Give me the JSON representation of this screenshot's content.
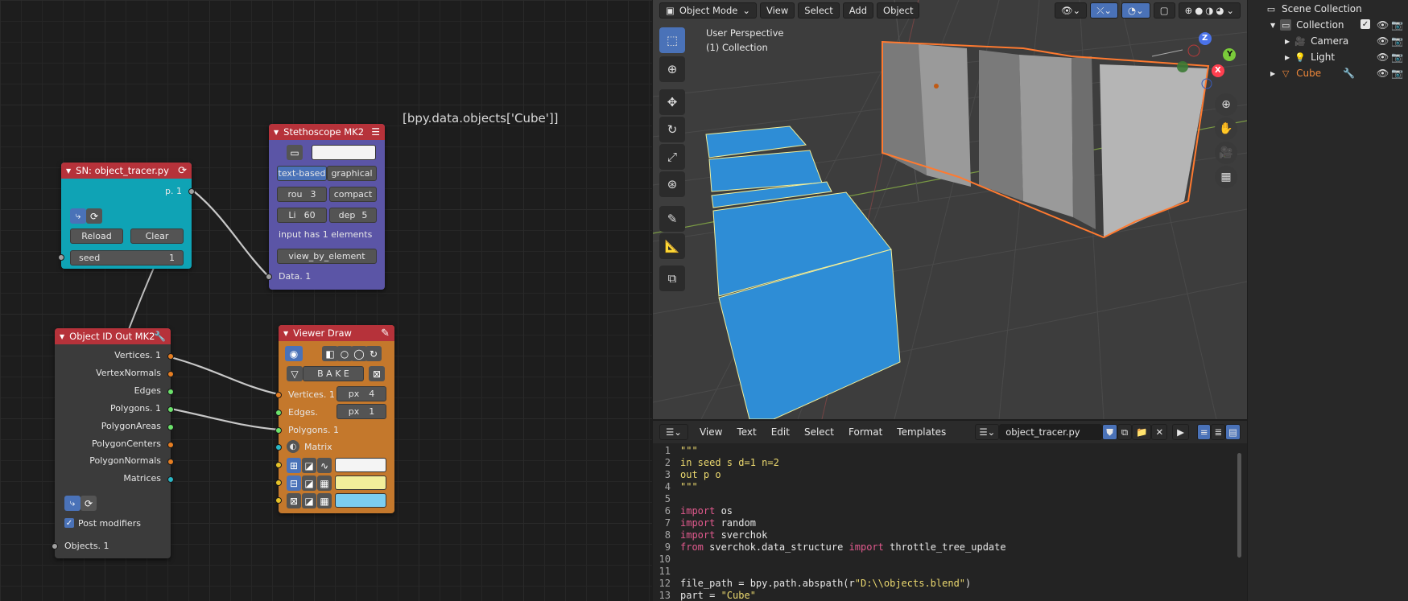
{
  "node_editor": {
    "floating_label": "[bpy.data.objects['Cube']]",
    "sn_node": {
      "title": "SN: object_tracer.py",
      "output": "p. 1",
      "reload": "Reload",
      "clear": "Clear",
      "seed_label": "seed",
      "seed_value": "1"
    },
    "stethoscope": {
      "title": "Stethoscope MK2",
      "mode_text": "text-based",
      "mode_graph": "graphical",
      "rou_label": "rou",
      "rou_value": "3",
      "compact": "compact",
      "li_label": "Li",
      "li_value": "60",
      "dep_label": "dep",
      "dep_value": "5",
      "info": "input has 1 elements",
      "view_btn": "view_by_element",
      "data_in": "Data. 1"
    },
    "object_id": {
      "title": "Object ID Out MK2",
      "outputs": [
        "Vertices. 1",
        "VertexNormals",
        "Edges",
        "Polygons. 1",
        "PolygonAreas",
        "PolygonCenters",
        "PolygonNormals",
        "Matrices"
      ],
      "post_modifiers": "Post modifiers",
      "objects_in": "Objects. 1"
    },
    "viewer": {
      "title": "Viewer Draw",
      "bake": "B A K E",
      "vertices": "Vertices. 1",
      "edges": "Edges.",
      "polygons": "Polygons. 1",
      "matrix": "Matrix",
      "px_label": "px",
      "px_vert": "4",
      "px_edge": "1",
      "colors": {
        "vert": "#f4f4f4",
        "edge": "#f2ef9a",
        "poly": "#7ccdf0"
      }
    }
  },
  "viewport": {
    "mode": "Object Mode",
    "menus": [
      "View",
      "Select",
      "Add",
      "Object"
    ],
    "perspective": "User Perspective",
    "collection": "(1) Collection",
    "axes": {
      "x": "X",
      "y": "Y",
      "z": "Z"
    }
  },
  "text_editor": {
    "menus": [
      "View",
      "Text",
      "Edit",
      "Select",
      "Format",
      "Templates"
    ],
    "filename": "object_tracer.py",
    "lines": [
      {
        "n": "1",
        "parts": [
          {
            "t": "\"\"\"",
            "c": "y"
          }
        ]
      },
      {
        "n": "2",
        "parts": [
          {
            "t": "in seed s d=1 n=2",
            "c": "y"
          }
        ]
      },
      {
        "n": "3",
        "parts": [
          {
            "t": "out p o",
            "c": "y"
          }
        ]
      },
      {
        "n": "4",
        "parts": [
          {
            "t": "\"\"\"",
            "c": "y"
          }
        ]
      },
      {
        "n": "5",
        "parts": []
      },
      {
        "n": "6",
        "parts": [
          {
            "t": "import",
            "c": "k"
          },
          {
            "t": " os",
            "c": "w"
          }
        ]
      },
      {
        "n": "7",
        "parts": [
          {
            "t": "import",
            "c": "k"
          },
          {
            "t": " random",
            "c": "w"
          }
        ]
      },
      {
        "n": "8",
        "parts": [
          {
            "t": "import",
            "c": "k"
          },
          {
            "t": " sverchok",
            "c": "w"
          }
        ]
      },
      {
        "n": "9",
        "parts": [
          {
            "t": "from",
            "c": "k"
          },
          {
            "t": " sverchok.data_structure ",
            "c": "w"
          },
          {
            "t": "import",
            "c": "k"
          },
          {
            "t": " throttle_tree_update",
            "c": "w"
          }
        ]
      },
      {
        "n": "10",
        "parts": []
      },
      {
        "n": "11",
        "parts": []
      },
      {
        "n": "12",
        "parts": [
          {
            "t": "file_path = bpy.path.abspath(r",
            "c": "w"
          },
          {
            "t": "\"D:\\\\objects.blend\"",
            "c": "y"
          },
          {
            "t": ")",
            "c": "w"
          }
        ]
      },
      {
        "n": "13",
        "parts": [
          {
            "t": "part = ",
            "c": "w"
          },
          {
            "t": "\"Cube\"",
            "c": "y"
          }
        ]
      }
    ]
  },
  "outliner": {
    "scene_collection": "Scene Collection",
    "items": [
      {
        "label": "Collection",
        "indent": 1
      },
      {
        "label": "Camera",
        "indent": 2
      },
      {
        "label": "Light",
        "indent": 2
      },
      {
        "label": "Cube",
        "indent": 1
      }
    ]
  }
}
